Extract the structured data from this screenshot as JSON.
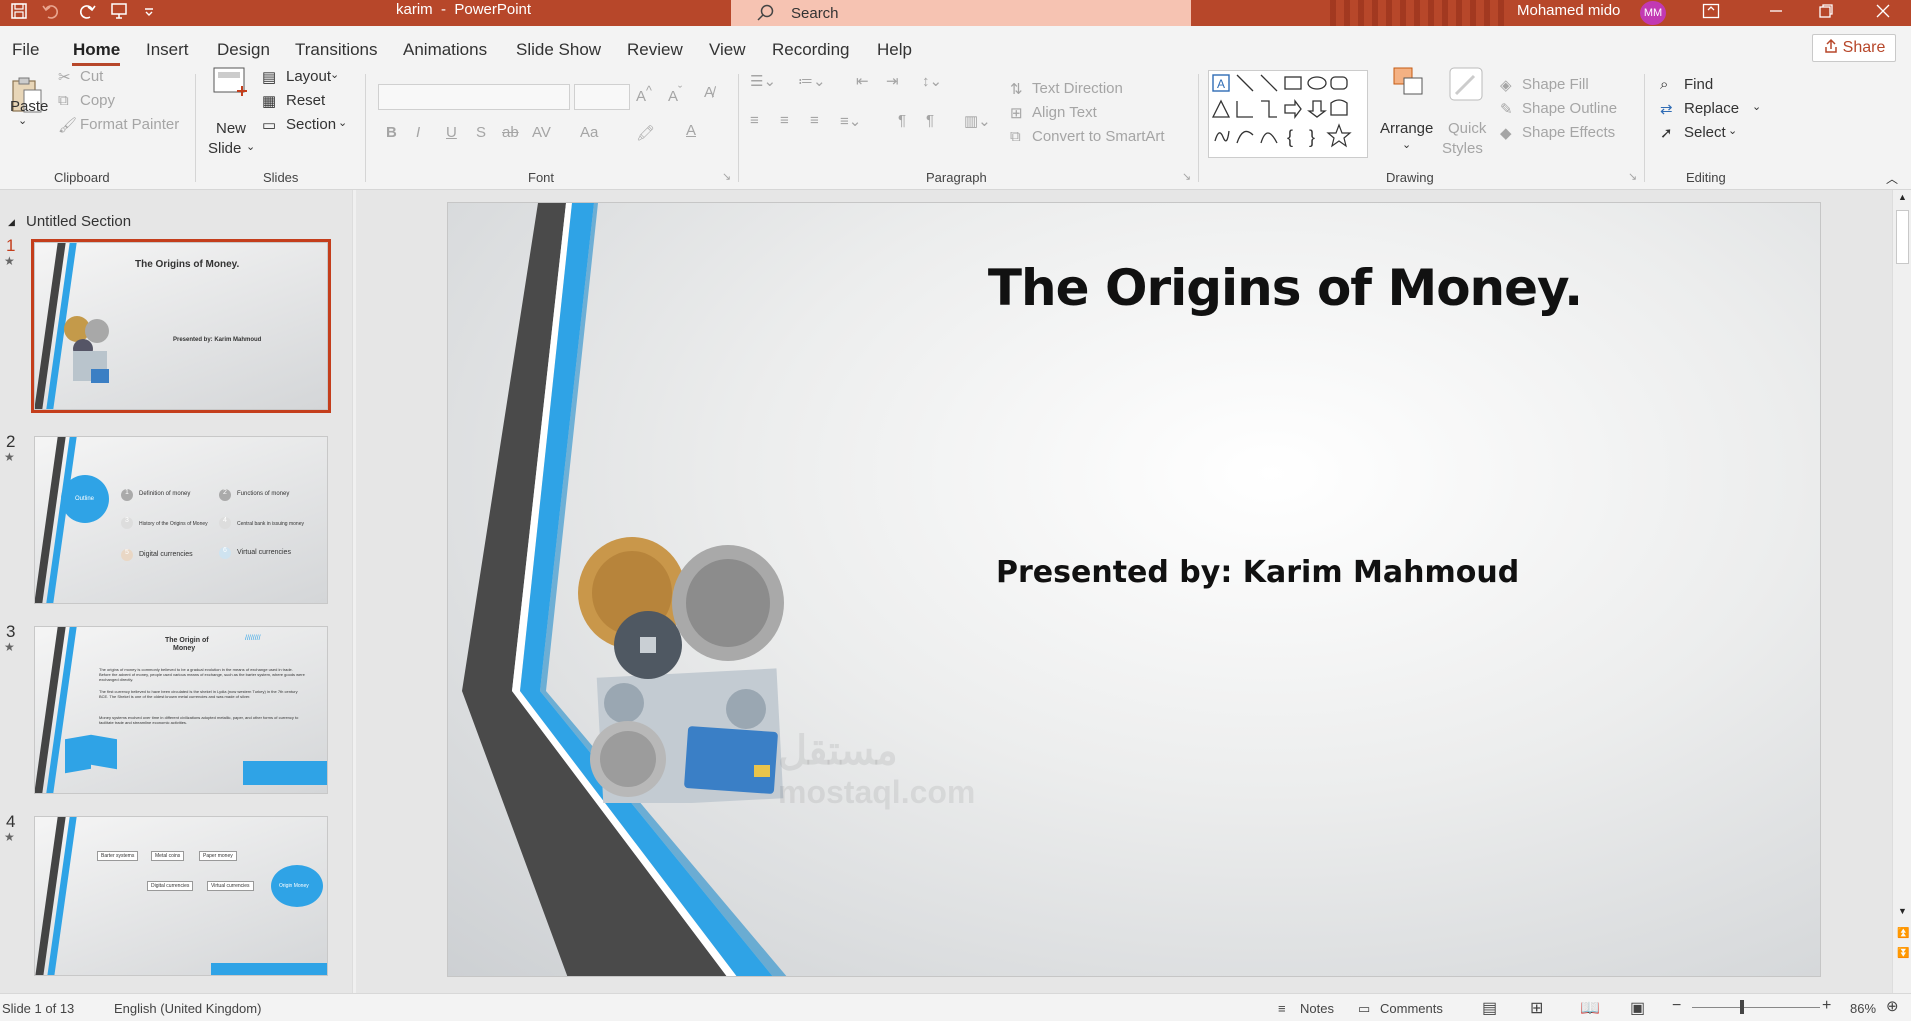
{
  "titlebar": {
    "file_name": "karim",
    "app_name": "PowerPoint",
    "search_placeholder": "Search",
    "user_name": "Mohamed mido",
    "user_initials": "MM",
    "accent_color": "#b7472a"
  },
  "menu": {
    "tabs": [
      "File",
      "Home",
      "Insert",
      "Design",
      "Transitions",
      "Animations",
      "Slide Show",
      "Review",
      "View",
      "Recording",
      "Help"
    ],
    "active_tab": "Home",
    "share_label": "Share"
  },
  "ribbon": {
    "clipboard": {
      "paste": "Paste",
      "cut": "Cut",
      "copy": "Copy",
      "format_painter": "Format Painter",
      "group_label": "Clipboard"
    },
    "slides": {
      "new_slide_line1": "New",
      "new_slide_line2": "Slide",
      "layout": "Layout",
      "reset": "Reset",
      "section": "Section",
      "group_label": "Slides"
    },
    "font": {
      "group_label": "Font",
      "bold": "B",
      "italic": "I",
      "underline": "U",
      "shadow": "S",
      "strike": "ab",
      "spacing": "AV",
      "case": "Aa"
    },
    "paragraph": {
      "group_label": "Paragraph",
      "text_direction": "Text Direction",
      "align_text": "Align Text",
      "smartart": "Convert to SmartArt"
    },
    "drawing": {
      "group_label": "Drawing",
      "arrange": "Arrange",
      "quick_styles_line1": "Quick",
      "quick_styles_line2": "Styles",
      "shape_fill": "Shape Fill",
      "shape_outline": "Shape Outline",
      "shape_effects": "Shape Effects"
    },
    "editing": {
      "group_label": "Editing",
      "find": "Find",
      "replace": "Replace",
      "select": "Select"
    }
  },
  "sidebar": {
    "section_title": "Untitled Section",
    "thumbnails": [
      {
        "number": "1",
        "title": "The Origins of Money.",
        "subtitle": "Presented by: Karim Mahmoud"
      },
      {
        "number": "2",
        "center_label": "Outline",
        "items": [
          "Definition of money",
          "Functions of money",
          "History of the Origins of Money",
          "Central bank in issuing money",
          "Digital currencies",
          "Virtual currencies"
        ],
        "item_numbers": [
          "1",
          "2",
          "3",
          "4",
          "5",
          "6"
        ]
      },
      {
        "number": "3",
        "title_line1": "The Origin of",
        "title_line2": "Money",
        "body": [
          "The origins of money is commonly believed to be a gradual evolution in the means of exchange used in trade. Before the advent of money, people used various means of exchange, such as the barter system, where goods were exchanged directly.",
          "The first currency believed to have been circulated is the shekel in Lydia (now western Turkey) in the 7th century BCE. The Shekel is one of the oldest known metal currencies and was made of silver.",
          "Money systems evolved over time in different civilizations adopted metallic, paper, and other forms of currency to facilitate trade and streamline economic activities."
        ]
      },
      {
        "number": "4",
        "flow": [
          "Barter systems",
          "Metal coins",
          "Paper money",
          "Digital currencies",
          "Virtual currencies"
        ],
        "circle_label": "Origin Money"
      }
    ]
  },
  "slide": {
    "title": "The Origins of Money.",
    "subtitle": "Presented by: Karim Mahmoud",
    "watermark_line1": "مستقل",
    "watermark_line2": "mostaql.com"
  },
  "statusbar": {
    "slide_info": "Slide 1 of 13",
    "language": "English (United Kingdom)",
    "notes": "Notes",
    "comments": "Comments",
    "zoom_minus": "−",
    "zoom_plus": "+",
    "zoom": "86%"
  }
}
